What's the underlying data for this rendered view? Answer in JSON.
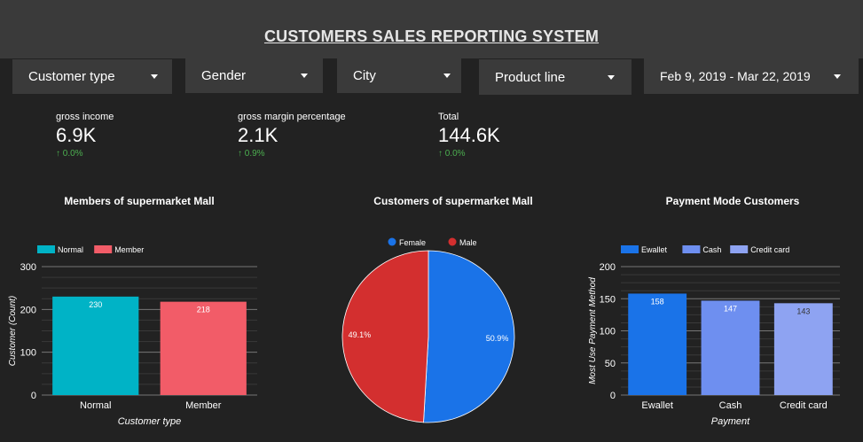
{
  "header": {
    "title": "CUSTOMERS SALES REPORTING SYSTEM"
  },
  "filters": [
    {
      "label": "Customer type"
    },
    {
      "label": "Gender"
    },
    {
      "label": "City"
    },
    {
      "label": "Product line"
    },
    {
      "label": "Feb 9, 2019 - Mar 22, 2019"
    }
  ],
  "kpis": [
    {
      "label": "gross income",
      "value": "6.9K",
      "change": "0.0%"
    },
    {
      "label": "gross margin percentage",
      "value": "2.1K",
      "change": "0.9%"
    },
    {
      "label": "Total",
      "value": "144.6K",
      "change": "0.0%"
    }
  ],
  "colors": {
    "teal": "#00b3c6",
    "salmon": "#f25c68",
    "blue": "#1a73e8",
    "red": "#d32f2f",
    "grid": "#555555"
  },
  "chart_data": [
    {
      "type": "bar",
      "title": "Members of supermarket Mall",
      "categories": [
        "Normal",
        "Member"
      ],
      "values": [
        230,
        218
      ],
      "data_labels": [
        "230",
        "218"
      ],
      "colors": [
        "#00b3c6",
        "#f25c68"
      ],
      "legend": [
        "Normal",
        "Member"
      ],
      "legend_position": "top-left",
      "xlabel": "Customer type",
      "ylabel": "Customer (Count)",
      "yticks": [
        "0",
        "100",
        "200",
        "300"
      ],
      "ylim": [
        0,
        300
      ],
      "grid": true
    },
    {
      "type": "pie",
      "title": "Customers of supermarket Mall",
      "labels": [
        "Female",
        "Male"
      ],
      "values": [
        50.9,
        49.1
      ],
      "data_labels": [
        "50.9%",
        "49.1%"
      ],
      "colors": [
        "#1a73e8",
        "#d32f2f"
      ],
      "legend_position": "top"
    },
    {
      "type": "bar",
      "title": "Payment Mode Customers",
      "categories": [
        "Ewallet",
        "Cash",
        "Credit card"
      ],
      "values": [
        158,
        147,
        143
      ],
      "data_labels": [
        "158",
        "147",
        "143"
      ],
      "colors": [
        "#1a73e8",
        "#6e8ff0",
        "#8ea3f2"
      ],
      "legend": [
        "Ewallet",
        "Cash",
        "Credit card"
      ],
      "legend_position": "top-left",
      "xlabel": "Payment",
      "ylabel": "Most Use Payment Method",
      "yticks": [
        "0",
        "50",
        "100",
        "150",
        "200"
      ],
      "ylim": [
        0,
        200
      ],
      "grid": true
    }
  ]
}
